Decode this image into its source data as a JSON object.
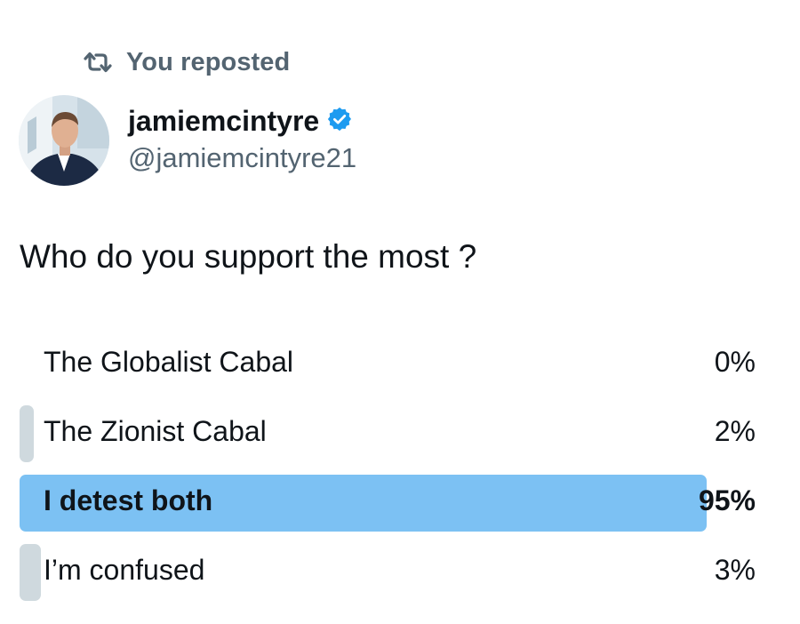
{
  "repost": {
    "label": "You reposted"
  },
  "author": {
    "display_name": "jamiemcintyre",
    "handle": "@jamiemcintyre21",
    "verified": true
  },
  "tweet": {
    "text": "Who do you support the most ?"
  },
  "poll": {
    "options": [
      {
        "label": "The Globalist Cabal",
        "percent": "0%",
        "value": 0
      },
      {
        "label": "The Zionist Cabal",
        "percent": "2%",
        "value": 2
      },
      {
        "label": "I detest both",
        "percent": "95%",
        "value": 95
      },
      {
        "label": "I’m confused",
        "percent": "3%",
        "value": 3
      }
    ],
    "winner_index": 2
  },
  "colors": {
    "accent": "#1d9bf0",
    "winner_bar": "#7cc1f3",
    "loser_bar": "#cfd9de",
    "secondary_text": "#536471",
    "primary_text": "#0f1419"
  },
  "icons": {
    "repost": "repost-icon",
    "verified": "verified-badge-icon"
  }
}
